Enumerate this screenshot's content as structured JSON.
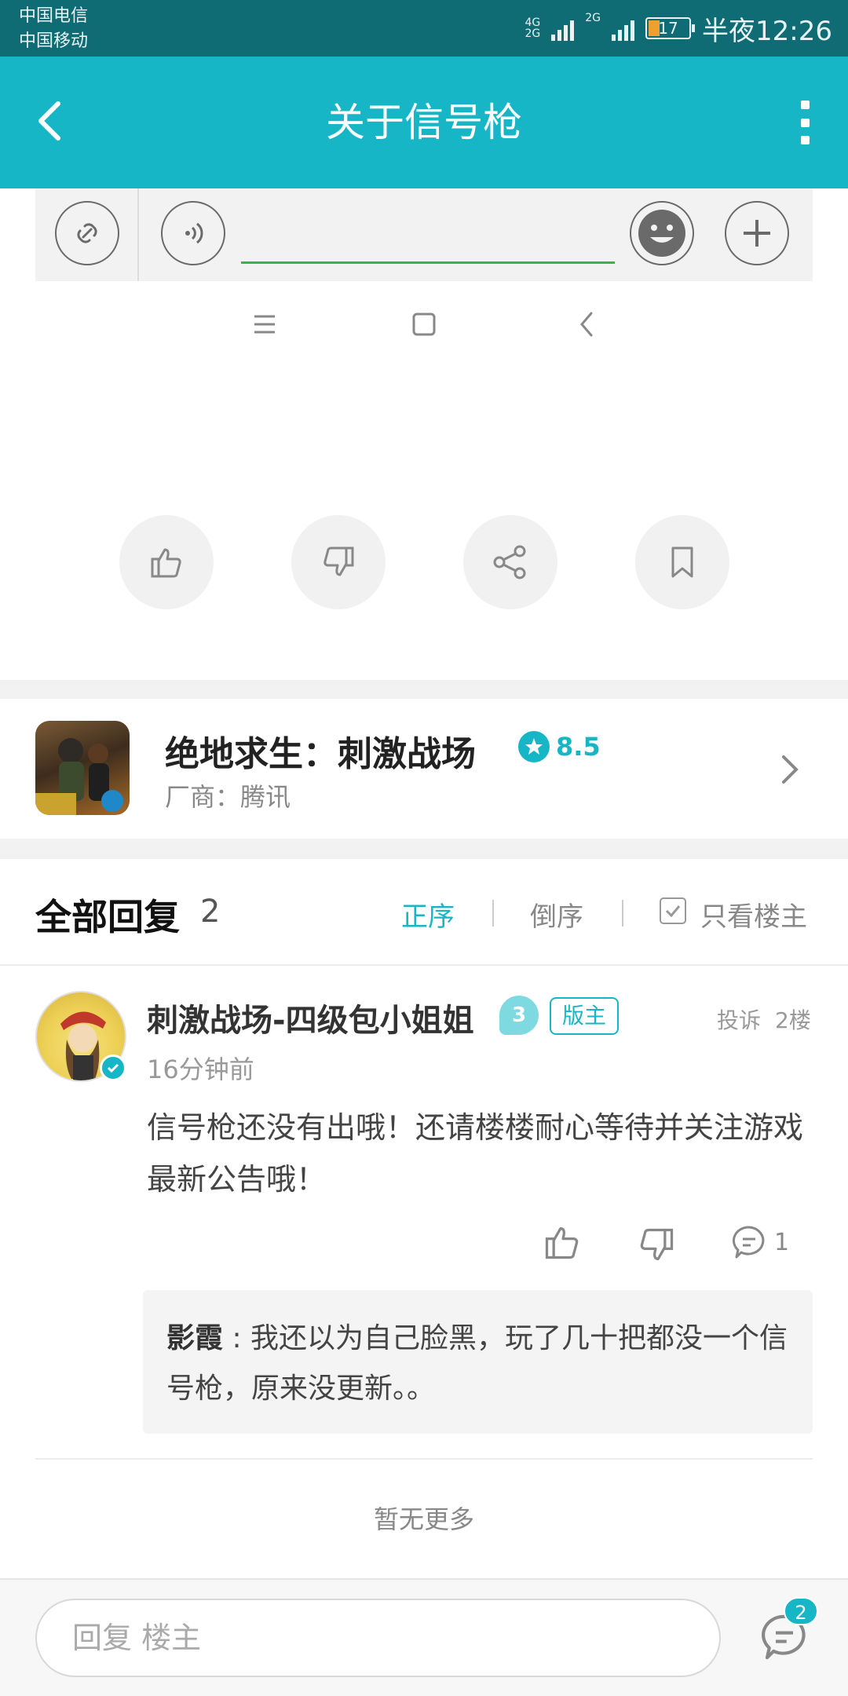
{
  "status_bar": {
    "carrier1": "中国电信",
    "carrier2": "中国移动",
    "net1": "4G",
    "net1b": "2G",
    "net2": "2G",
    "battery": "17",
    "time": "半夜12:26"
  },
  "header": {
    "title": "关于信号枪"
  },
  "actions": {
    "like_icon": "thumb-up-icon",
    "dislike_icon": "thumb-down-icon",
    "share_icon": "share-icon",
    "bookmark_icon": "bookmark-icon"
  },
  "game": {
    "title": "绝地求生：刺激战场",
    "rating": "8.5",
    "vendor": "厂商：腾讯"
  },
  "replies": {
    "title": "全部回复",
    "count": "2",
    "sort_asc": "正序",
    "sort_desc": "倒序",
    "owner_only": "只看楼主"
  },
  "comment": {
    "username": "刺激战场-四级包小姐姐",
    "level": "3",
    "badge": "版主",
    "report": "投诉",
    "floor": "2楼",
    "time": "16分钟前",
    "text": "信号枪还没有出哦！还请楼楼耐心等待并关注游戏最新公告哦！",
    "reply_count": "1",
    "sub_reply": {
      "author": "影霞",
      "text": "我还以为自己脸黑，玩了几十把都没一个信号枪，原来没更新。。"
    }
  },
  "footer": {
    "no_more": "暂无更多",
    "reply_placeholder": "回复  楼主",
    "chat_badge": "2"
  },
  "colors": {
    "accent": "#17b6c6",
    "statusbar": "#0f6b74",
    "input_line": "#2fb84a"
  }
}
